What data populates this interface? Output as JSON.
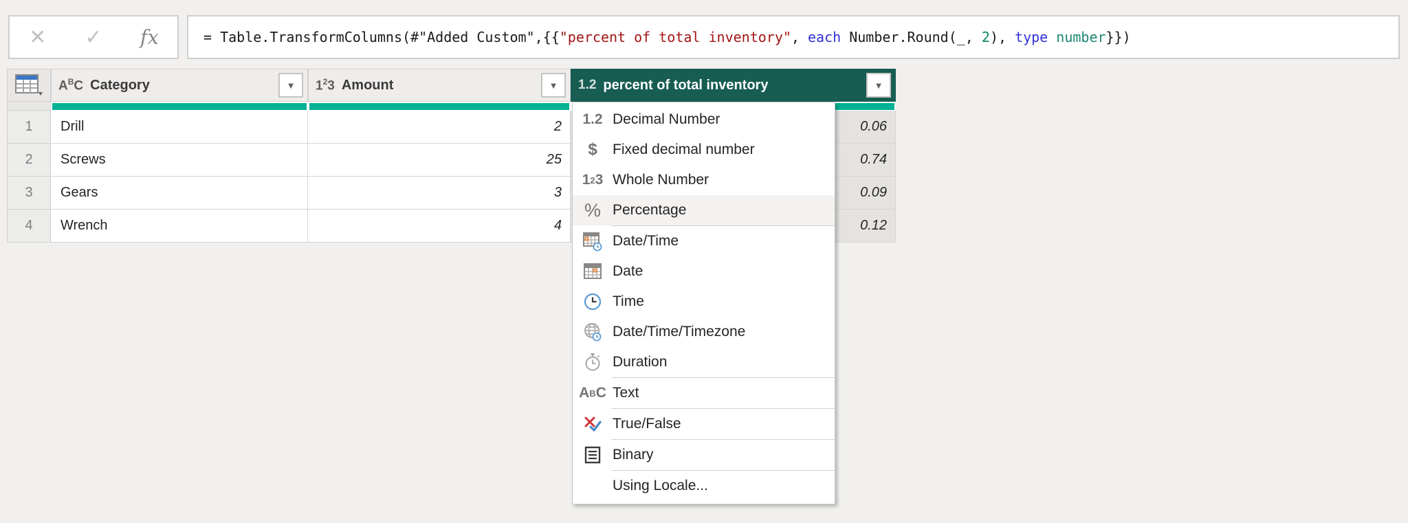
{
  "colors": {
    "accent_quality_bar": "#00b294",
    "selected_header_bg": "#175d52",
    "formula_string_red": "#a31515",
    "formula_keyword_blue": "#3131d9",
    "formula_number_green": "#098658",
    "formula_typename_teal": "#1d8573"
  },
  "formula_bar": {
    "cancel_icon": "✕",
    "commit_icon": "✓",
    "fx_icon": "fx",
    "formula": {
      "s1": "= Table.TransformColumns(#\"Added Custom\",{{",
      "s2": "\"percent of total inventory\"",
      "s3": ", ",
      "s4": "each",
      "s5": " Number.Round(_, ",
      "s6": "2",
      "s7": "), ",
      "s8": "type",
      "s9": " ",
      "s10": "number",
      "s11": "}})"
    }
  },
  "table": {
    "type_glyphs": {
      "text_a": "A",
      "text_b": "B",
      "text_c": "C",
      "whole_1": "1",
      "whole_2": "2",
      "whole_3": "3",
      "decimal": "1.2",
      "percent_sign": "%",
      "currency_sign": "$"
    },
    "columns": [
      {
        "label": "Category",
        "type": "text"
      },
      {
        "label": "Amount",
        "type": "whole-number"
      },
      {
        "label": "percent of total inventory",
        "type": "decimal-number",
        "selected": true
      }
    ],
    "rows": [
      {
        "num": "1",
        "category": "Drill",
        "amount": "2",
        "percent": "0.06"
      },
      {
        "num": "2",
        "category": "Screws",
        "amount": "25",
        "percent": "0.74"
      },
      {
        "num": "3",
        "category": "Gears",
        "amount": "3",
        "percent": "0.09"
      },
      {
        "num": "4",
        "category": "Wrench",
        "amount": "4",
        "percent": "0.12"
      }
    ]
  },
  "type_menu": {
    "items": [
      {
        "icon": "decimal-number-icon",
        "label": "Decimal Number"
      },
      {
        "icon": "currency-icon",
        "label": "Fixed decimal number"
      },
      {
        "icon": "whole-number-icon",
        "label": "Whole Number"
      },
      {
        "icon": "percentage-icon",
        "label": "Percentage",
        "highlighted": true
      },
      {
        "icon": "datetime-icon",
        "label": "Date/Time"
      },
      {
        "icon": "date-icon",
        "label": "Date"
      },
      {
        "icon": "time-icon",
        "label": "Time"
      },
      {
        "icon": "datetimezone-icon",
        "label": "Date/Time/Timezone"
      },
      {
        "icon": "duration-icon",
        "label": "Duration"
      },
      {
        "icon": "text-icon",
        "label": "Text"
      },
      {
        "icon": "truefalse-icon",
        "label": "True/False"
      },
      {
        "icon": "binary-icon",
        "label": "Binary"
      },
      {
        "icon": "none",
        "label": "Using Locale..."
      }
    ]
  }
}
